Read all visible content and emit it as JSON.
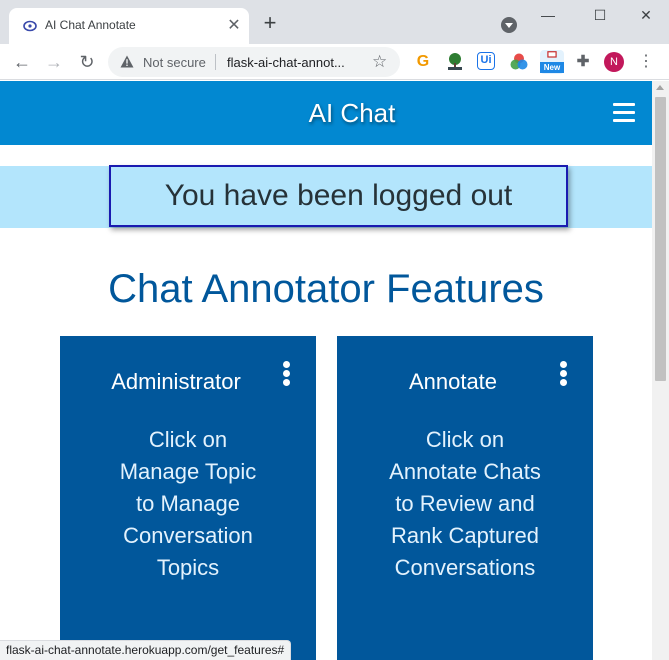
{
  "browser": {
    "tab_title": "AI Chat Annotate",
    "tab_close": "✕",
    "new_tab": "+",
    "window_minimize": "—",
    "window_maximize": "☐",
    "window_close": "✕",
    "back": "←",
    "forward": "→",
    "reload": "↻",
    "security_label": "Not secure",
    "url": "flask-ai-chat-annot...",
    "bookmark": "☆",
    "ext_g": "G",
    "ext_ui": "Ui",
    "ext_new": "New",
    "ext_puzzle": "✚",
    "profile_initial": "N",
    "menu": "⋮",
    "status_url": "flask-ai-chat-annotate.herokuapp.com/get_features#"
  },
  "app": {
    "title": "AI Chat",
    "flash_message": "You have been logged out",
    "features_title": "Chat Annotator Features",
    "cards": [
      {
        "title": "Administrator",
        "body_lines": [
          "Click on",
          "Manage Topic",
          "to Manage",
          "Conversation",
          "Topics"
        ]
      },
      {
        "title": "Annotate",
        "body_lines": [
          "Click on",
          "Annotate Chats",
          "to Review and",
          "Rank Captured",
          "Conversations"
        ]
      }
    ]
  },
  "colors": {
    "appbar": "#0288d1",
    "flash_background": "#b3e5fc",
    "flash_border": "#1a1ab0",
    "heading": "#01579b",
    "card": "#01579b",
    "profile": "#c2185b"
  },
  "icons": {
    "favicon": "chat-logo-icon",
    "warning": "warning-triangle-icon",
    "menu": "hamburger-menu-icon",
    "card_menu": "kebab-menu-icon"
  }
}
